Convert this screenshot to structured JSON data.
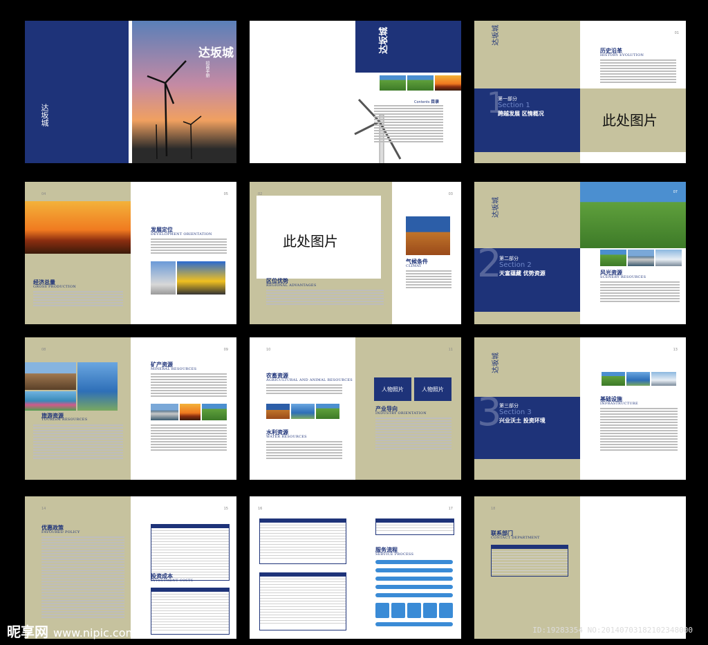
{
  "brand": {
    "title": "达坂城",
    "tagline": "招商手册",
    "vertical_title": "达坂城"
  },
  "toc": {
    "contents_label": "Contents",
    "toc_label": "目录"
  },
  "section1": {
    "part_label": "第一部分",
    "en_label": "Section 1",
    "title": "跨越发展 区情概况",
    "number": "1"
  },
  "section2": {
    "part_label": "第二部分",
    "en_label": "Section 2",
    "title": "天富蕴藏 优势资源",
    "number": "2"
  },
  "section3": {
    "part_label": "第三部分",
    "en_label": "Section 3",
    "title": "兴业沃土 投资环境",
    "number": "3"
  },
  "placeholder_image": "此处图片",
  "placeholder_person": "人物照片",
  "headings": {
    "history": "历史沿革",
    "history_en": "HISTORY EVOLUTION",
    "development": "发展定位",
    "development_en": "DEVELOPMENT ORIENTATION",
    "economy": "经济总量",
    "economy_en": "GROSS PRODUCTION",
    "location": "区位优势",
    "location_en": "REGIONAL ADVANTAGES",
    "climate": "气候条件",
    "climate_en": "CLIMAT",
    "scenery": "风光资源",
    "scenery_en": "SCENERY RESOURCES",
    "mineral": "矿产资源",
    "mineral_en": "MINERAL RESOURCES",
    "tourism": "旅游资源",
    "tourism_en": "TOURISM RESOURCES",
    "agri": "农畜资源",
    "agri_en": "AGRICULTURAL AND ANIMAL RESOURCES",
    "industry": "产业导向",
    "industry_en": "INDUSTRY ORIENTATION",
    "water": "水利资源",
    "water_en": "WATER RESOURCES",
    "infra": "基础设施",
    "infra_en": "INFRASTRUCTURE",
    "policy": "优惠政策",
    "policy_en": "FAVOURED POLICY",
    "cost": "投资成本",
    "cost_en": "INVESTMENT COSTS",
    "service": "服务流程",
    "service_en": "SERVICE PROCESS",
    "contact": "联系部门",
    "contact_en": "CONTACT DEPARTMENT"
  },
  "page_numbers": {
    "p01": "01",
    "p04": "04",
    "p05": "05",
    "p02": "02",
    "p03": "03",
    "p07": "07",
    "p08": "08",
    "p09": "09",
    "p10": "10",
    "p11": "11",
    "p13": "13",
    "p14": "14",
    "p15": "15",
    "p16": "16",
    "p17": "17",
    "p18": "18"
  },
  "footer": {
    "watermark_cn": "昵享网",
    "watermark_url": "www.nipic.com",
    "id_text": "ID:19283354 NO:20140703182102348000"
  }
}
